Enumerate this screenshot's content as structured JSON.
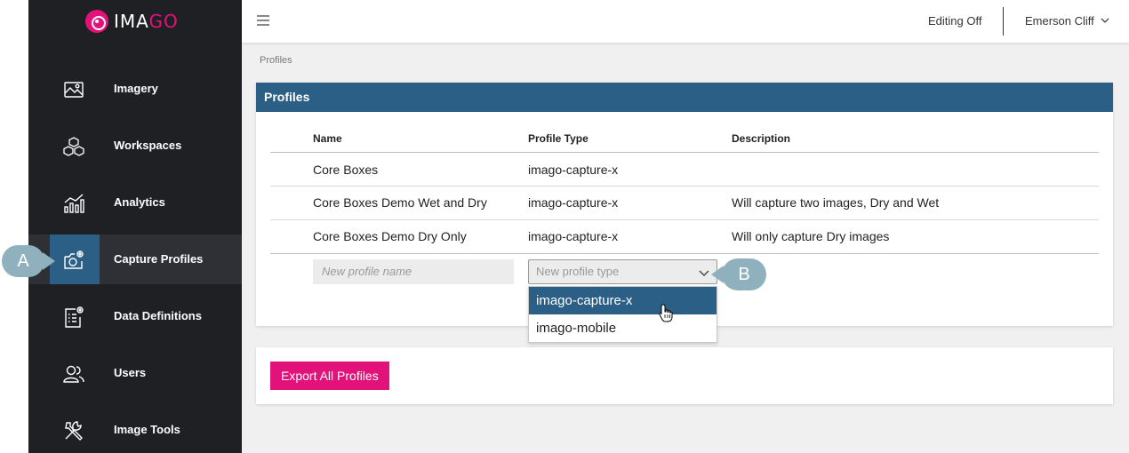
{
  "brand": {
    "logo_prefix": "IMA",
    "logo_accent": "GO"
  },
  "sidebar": {
    "items": [
      {
        "label": "Imagery",
        "icon": "image-icon"
      },
      {
        "label": "Workspaces",
        "icon": "cubes-icon"
      },
      {
        "label": "Analytics",
        "icon": "chart-icon"
      },
      {
        "label": "Capture Profiles",
        "icon": "camera-settings-icon",
        "active": true
      },
      {
        "label": "Data Definitions",
        "icon": "list-settings-icon"
      },
      {
        "label": "Users",
        "icon": "users-icon"
      },
      {
        "label": "Image Tools",
        "icon": "tools-icon"
      }
    ]
  },
  "topbar": {
    "editing": "Editing Off",
    "user": "Emerson Cliff"
  },
  "breadcrumb": "Profiles",
  "panel": {
    "title": "Profiles",
    "columns": [
      "Name",
      "Profile Type",
      "Description"
    ],
    "rows": [
      {
        "name": "Core Boxes",
        "type": "imago-capture-x",
        "description": ""
      },
      {
        "name": "Core Boxes Demo Wet and Dry",
        "type": "imago-capture-x",
        "description": "Will capture two images, Dry and Wet"
      },
      {
        "name": "Core Boxes Demo Dry Only",
        "type": "imago-capture-x",
        "description": "Will only capture Dry images"
      }
    ],
    "new_name_placeholder": "New profile name",
    "new_type_placeholder": "New profile type",
    "type_options": [
      "imago-capture-x",
      "imago-mobile"
    ],
    "highlighted_option": "imago-capture-x"
  },
  "export_button": "Export All Profiles",
  "callouts": {
    "a": "A",
    "b": "B"
  },
  "colors": {
    "accent": "#e3127a",
    "primary": "#2b5f85",
    "sidebar": "#1f2024"
  }
}
